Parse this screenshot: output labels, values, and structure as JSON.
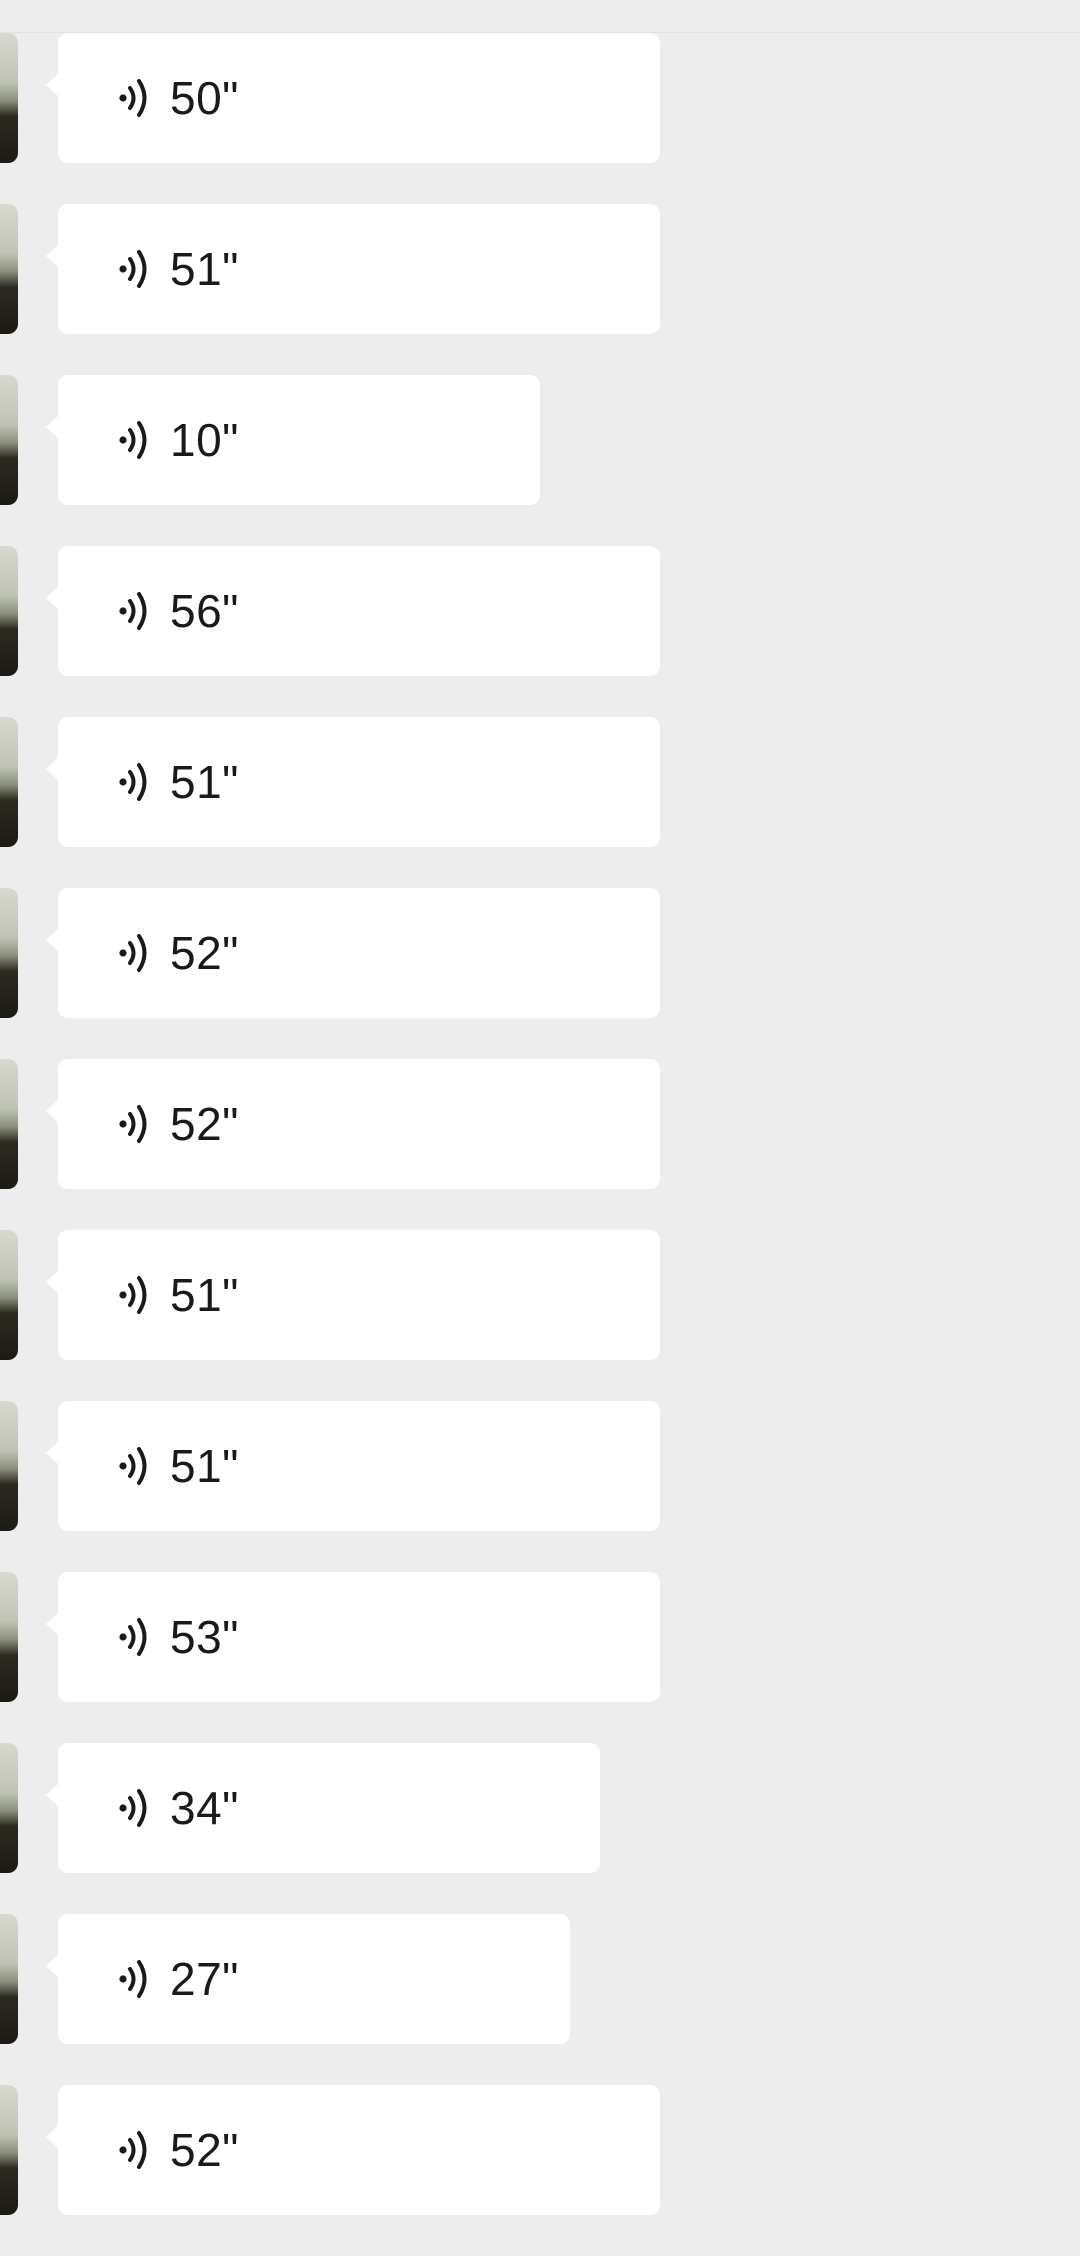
{
  "messages": [
    {
      "duration": "50\"",
      "icon": "voice-icon"
    },
    {
      "duration": "51\"",
      "icon": "voice-icon"
    },
    {
      "duration": "10\"",
      "icon": "voice-icon"
    },
    {
      "duration": "56\"",
      "icon": "voice-icon"
    },
    {
      "duration": "51\"",
      "icon": "voice-icon"
    },
    {
      "duration": "52\"",
      "icon": "voice-icon"
    },
    {
      "duration": "52\"",
      "icon": "voice-icon"
    },
    {
      "duration": "51\"",
      "icon": "voice-icon"
    },
    {
      "duration": "51\"",
      "icon": "voice-icon"
    },
    {
      "duration": "53\"",
      "icon": "voice-icon"
    },
    {
      "duration": "34\"",
      "icon": "voice-icon"
    },
    {
      "duration": "27\"",
      "icon": "voice-icon"
    },
    {
      "duration": "52\"",
      "icon": "voice-icon"
    }
  ],
  "colors": {
    "background": "#ededed",
    "bubble": "#ffffff",
    "text": "#1a1a1a"
  }
}
